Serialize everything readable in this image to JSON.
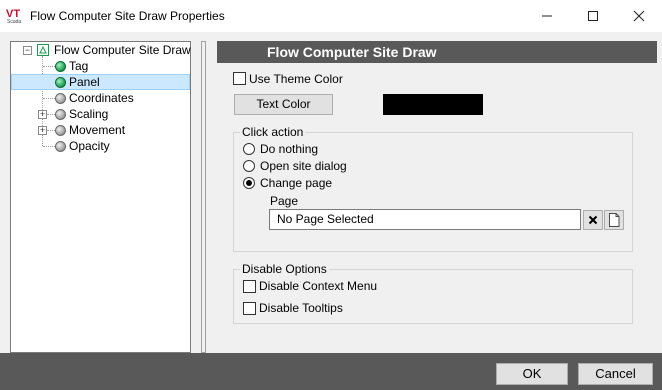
{
  "window": {
    "title": "Flow Computer Site Draw Properties",
    "logo_text": "VT",
    "logo_subtext": "Scada",
    "minimize_icon": "minimize-icon",
    "maximize_icon": "maximize-icon",
    "close_icon": "close-icon"
  },
  "tree": {
    "root_label": "Flow Computer Site Draw",
    "items": [
      {
        "label": "Tag",
        "status": "green",
        "selected": false,
        "expandable": false
      },
      {
        "label": "Panel",
        "status": "green",
        "selected": true,
        "expandable": false
      },
      {
        "label": "Coordinates",
        "status": "grey",
        "selected": false,
        "expandable": false
      },
      {
        "label": "Scaling",
        "status": "grey",
        "selected": false,
        "expandable": true
      },
      {
        "label": "Movement",
        "status": "grey",
        "selected": false,
        "expandable": true
      },
      {
        "label": "Opacity",
        "status": "grey",
        "selected": false,
        "expandable": false
      }
    ]
  },
  "panel": {
    "header": "Flow Computer Site Draw",
    "use_theme_color_label": "Use Theme Color",
    "use_theme_color_checked": false,
    "text_color_button": "Text Color",
    "text_color_value": "#000000",
    "click_action": {
      "title": "Click action",
      "options": [
        "Do nothing",
        "Open site dialog",
        "Change page"
      ],
      "selected": "Change page",
      "page_label": "Page",
      "page_value": "No Page Selected"
    },
    "disable_options": {
      "title": "Disable Options",
      "context_menu_label": "Disable Context Menu",
      "context_menu_checked": false,
      "tooltips_label": "Disable Tooltips",
      "tooltips_checked": false
    }
  },
  "footer": {
    "ok_label": "OK",
    "cancel_label": "Cancel"
  },
  "colors": {
    "header_bg": "#595959",
    "footer_bg": "#595959",
    "selection_bg": "#cce8ff",
    "window_bg": "#f0f0f0"
  }
}
